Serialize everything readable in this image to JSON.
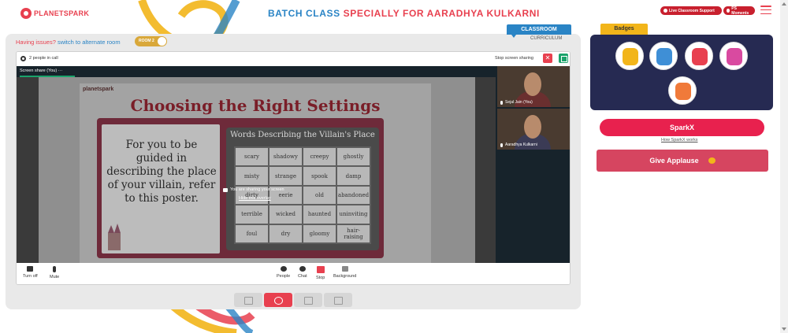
{
  "header": {
    "logo_text": "PLANETSPARK",
    "title_prefix": "BATCH CLASS ",
    "title_suffix": "SPECIALLY FOR AARADHYA KULKARNI",
    "live_support_label": "Live Classroom Support",
    "moments_label": "PS Moments"
  },
  "tabs": {
    "classroom": "CLASSROOM",
    "curriculum": "CURRICULUM"
  },
  "issues": {
    "question": "Having issues?",
    "link": "switch to alternate room",
    "toggle_label": "ROOM 2"
  },
  "call": {
    "people_count": "2 people in call",
    "stop_sharing": "Stop screen sharing",
    "stop_btn_glyph": "✕",
    "share_tab": "Screen share (You)  ···",
    "overlay_title": "You are sharing your screen",
    "overlay_link": "Hide this overlay",
    "participants": [
      {
        "name": "Sejal Jain (You)"
      },
      {
        "name": "Aaradhya Kulkarni"
      }
    ],
    "controls": {
      "turn_off": "Turn off",
      "mute": "Mute",
      "people": "People",
      "chat": "Chat",
      "stop": "Stop",
      "background": "Background"
    }
  },
  "slide": {
    "logo": "planetspark",
    "title": "Choosing the Right Settings",
    "poster_text": "For you to be guided in describing the place of your villain, refer to this poster.",
    "board_title": "Words Describing the Villain's Place",
    "words": [
      [
        "scary",
        "shadowy",
        "creepy",
        "ghostly"
      ],
      [
        "misty",
        "strange",
        "spook",
        "damp"
      ],
      [
        "dirty",
        "eerie",
        "old",
        "abandoned"
      ],
      [
        "terrible",
        "wicked",
        "haunted",
        "uninviting"
      ],
      [
        "foul",
        "dry",
        "gloomy",
        "hair-raising"
      ]
    ]
  },
  "right_panel": {
    "badges_tab": "Badges",
    "sparkx_label": "SparkX",
    "sparkx_link": "How SparkX works",
    "applause_label": "Give Applause"
  },
  "colors": {
    "brand_red": "#e8404f",
    "brand_blue": "#2a84c5",
    "badges_bg": "#262a52",
    "badges_tab": "#f2b51a",
    "sparkx": "#e8214e",
    "applause": "#d64560"
  }
}
